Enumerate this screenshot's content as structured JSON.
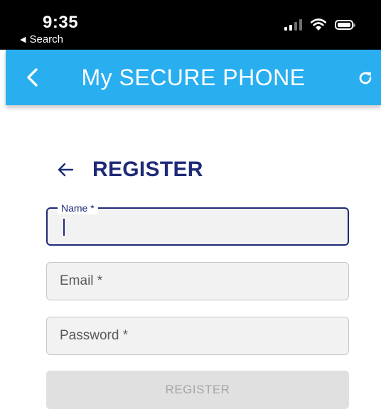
{
  "status_bar": {
    "time": "9:35",
    "back_label": "Search",
    "back_glyph": "◀",
    "icons": [
      "signal-icon",
      "wifi-icon",
      "battery-icon"
    ]
  },
  "app_bar": {
    "title": "My SECURE PHONE",
    "color": "#29aef0",
    "left_icon": "chevron-left-icon",
    "right_icon": "refresh-icon"
  },
  "form": {
    "title": "REGISTER",
    "title_color": "#1e2a78",
    "back_icon": "arrow-left-icon",
    "fields": {
      "name": {
        "label": "Name *",
        "value": "",
        "focused": true
      },
      "email": {
        "label": "Email *",
        "value": ""
      },
      "password": {
        "label": "Password *",
        "value": ""
      }
    },
    "submit_label": "REGISTER",
    "submit_disabled": true
  }
}
